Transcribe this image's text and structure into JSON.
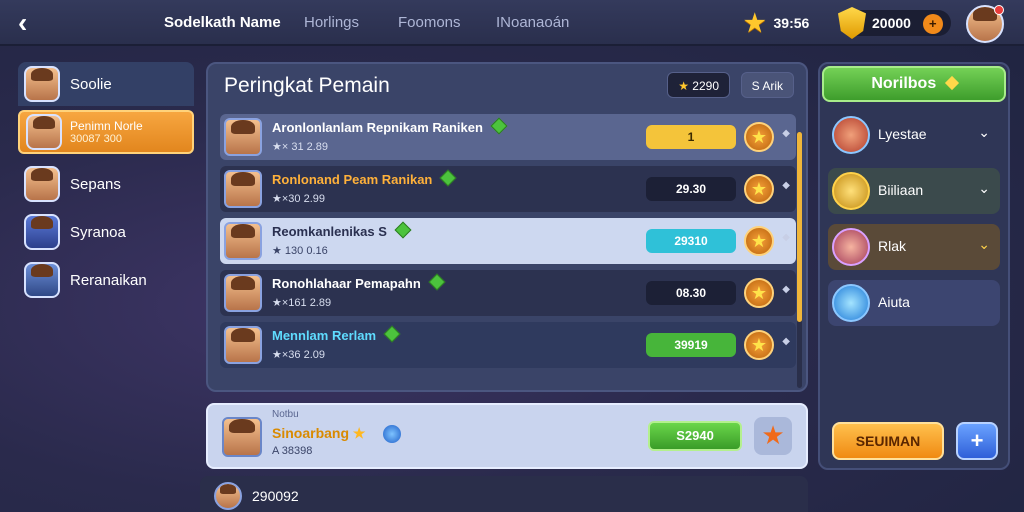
{
  "topbar": {
    "tabs": [
      "Sodelkath Name",
      "Horlings",
      "Foomons",
      "INoanaoán"
    ],
    "stars": "39:56",
    "gold": "20000"
  },
  "sidebar": {
    "items": [
      {
        "label": "Soolie",
        "sub": ""
      },
      {
        "label": "Penimn Norle",
        "sub": "30087 300"
      },
      {
        "label": "Sepans",
        "sub": ""
      },
      {
        "label": "Syranoa",
        "sub": ""
      },
      {
        "label": "Reranaikan",
        "sub": ""
      }
    ]
  },
  "main": {
    "title": "Peringkat Pemain",
    "score_pill_1": "2290",
    "score_pill_2": "S Arik",
    "rows": [
      {
        "name": "Aronlonlanlam Repnikam Raniken",
        "sub": "★× 31  2.89",
        "score": "1",
        "bg": "#5a6690",
        "score_bg": "#f4c43a",
        "score_color": "#3b2a00",
        "name_color": "#ffffff"
      },
      {
        "name": "Ronlonand Peam Ranikan",
        "sub": "★×30  2.99",
        "score": "29.30",
        "bg": "#2c3250",
        "score_bg": "#1c2036",
        "score_color": "#ffffff",
        "name_color": "#ffb13a"
      },
      {
        "name": "Reomkanlenikas S",
        "sub": "★ 130 0.16",
        "score": "29310",
        "bg": "#cdd8f0",
        "score_bg": "#2fc1d8",
        "score_color": "#ffffff",
        "name_color": "#2a3050"
      },
      {
        "name": "Ronohlahaar Pemapahn",
        "sub": "★×161  2.89",
        "score": "08.30",
        "bg": "#2c3250",
        "score_bg": "#1c2036",
        "score_color": "#ffffff",
        "name_color": "#ffffff"
      },
      {
        "name": "Mennlam Rerlam",
        "sub": "★×36  2.09",
        "score": "39919",
        "bg": "#2f3a5e",
        "score_bg": "#47b53a",
        "score_color": "#ffffff",
        "name_color": "#5fdcff"
      }
    ]
  },
  "my_rank": {
    "tag": "Notbu",
    "name": "Sinoarbang",
    "sub": "A 38398",
    "score": "S2940"
  },
  "right": {
    "header": "Norilbos",
    "items": [
      {
        "label": "Lyestae",
        "chevron": "⌄"
      },
      {
        "label": "Biiliaan",
        "chevron": "⌄"
      },
      {
        "label": "Rlak",
        "chevron": "⌄"
      },
      {
        "label": "Aiuta",
        "chevron": ""
      }
    ],
    "button_label": "SEUIMAN",
    "plus_label": "+"
  },
  "bottom": {
    "value": "290092"
  }
}
